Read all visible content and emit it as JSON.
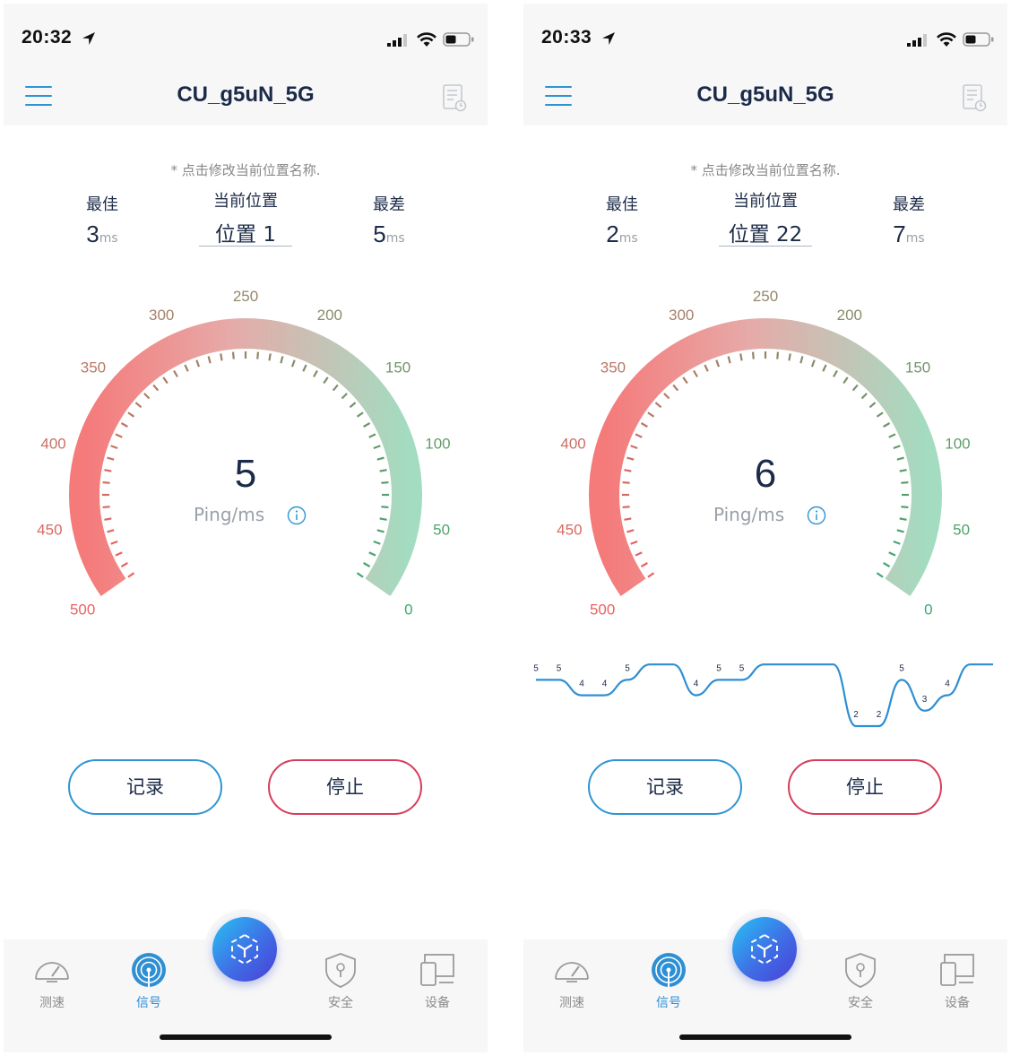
{
  "colors": {
    "accent_blue": "#2e95d3",
    "stop_red": "#d63d5b",
    "gauge_low": "#a3dcc0",
    "gauge_high": "#f57a7a"
  },
  "gauge": {
    "scale_labels": [
      "0",
      "50",
      "100",
      "150",
      "200",
      "250",
      "300",
      "350",
      "400",
      "450",
      "500"
    ],
    "ping_label": "Ping/ms"
  },
  "screens": [
    {
      "status": {
        "time": "20:32"
      },
      "header": {
        "title": "CU_g5uN_5G"
      },
      "hint": "* 点击修改当前位置名称.",
      "best": {
        "label": "最佳",
        "value": "3",
        "unit": "ms"
      },
      "current": {
        "label": "当前位置",
        "name": "位置 1"
      },
      "worst": {
        "label": "最差",
        "value": "5",
        "unit": "ms"
      },
      "reading": {
        "value": "5",
        "level": 5
      },
      "buttons": {
        "record": "记录",
        "stop": "停止"
      },
      "history": []
    },
    {
      "status": {
        "time": "20:33"
      },
      "header": {
        "title": "CU_g5uN_5G"
      },
      "hint": "* 点击修改当前位置名称.",
      "best": {
        "label": "最佳",
        "value": "2",
        "unit": "ms"
      },
      "current": {
        "label": "当前位置",
        "name": "位置 22"
      },
      "worst": {
        "label": "最差",
        "value": "7",
        "unit": "ms"
      },
      "reading": {
        "value": "6",
        "level": 6
      },
      "buttons": {
        "record": "记录",
        "stop": "停止"
      },
      "history": [
        5,
        5,
        4,
        4,
        5,
        6,
        6,
        4,
        5,
        5,
        6,
        6,
        6,
        6,
        2,
        2,
        5,
        3,
        4,
        6,
        6
      ]
    }
  ],
  "tabs": {
    "speed": "测速",
    "signal": "信号",
    "security": "安全",
    "devices": "设备"
  },
  "icons": [
    "location-arrow-icon",
    "cellular-signal-icon",
    "wifi-icon",
    "battery-icon",
    "menu-icon",
    "report-icon",
    "info-icon",
    "speedometer-icon",
    "signal-icon",
    "cube-icon",
    "shield-icon",
    "devices-icon"
  ]
}
